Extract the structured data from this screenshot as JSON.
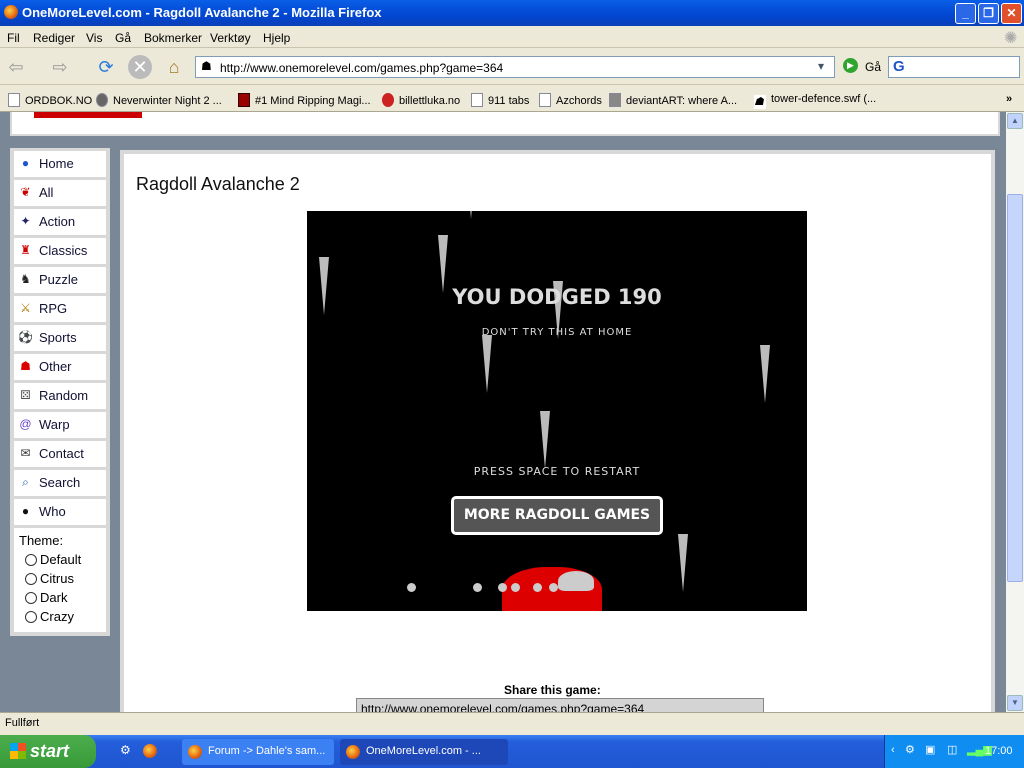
{
  "window": {
    "title": "OneMoreLevel.com - Ragdoll Avalanche 2 - Mozilla Firefox"
  },
  "menu": [
    "Fil",
    "Rediger",
    "Vis",
    "Gå",
    "Bokmerker",
    "Verktøy",
    "Hjelp"
  ],
  "toolbar": {
    "url": "http://www.onemorelevel.com/games.php?game=364",
    "go_label": "Gå"
  },
  "bookmarks": [
    "ORDBOK.NO",
    "Neverwinter Night 2 ...",
    "#1 Mind Ripping Magi...",
    "billettluka.no",
    "911 tabs",
    "Azchords",
    "deviantART: where A...",
    "tower-defence.swf (..."
  ],
  "sidebar": {
    "items": [
      {
        "label": "Home",
        "icon": "home-icon"
      },
      {
        "label": "All",
        "icon": "cherries-icon"
      },
      {
        "label": "Action",
        "icon": "action-icon"
      },
      {
        "label": "Classics",
        "icon": "mario-icon"
      },
      {
        "label": "Puzzle",
        "icon": "chess-icon"
      },
      {
        "label": "RPG",
        "icon": "swords-icon"
      },
      {
        "label": "Sports",
        "icon": "ball-icon"
      },
      {
        "label": "Other",
        "icon": "ghost-icon"
      },
      {
        "label": "Random",
        "icon": "dice-icon"
      },
      {
        "label": "Warp",
        "icon": "spiral-icon"
      },
      {
        "label": "Contact",
        "icon": "envelope-icon"
      },
      {
        "label": "Search",
        "icon": "magnifier-icon"
      },
      {
        "label": "Who",
        "icon": "person-icon"
      }
    ],
    "theme_label": "Theme:",
    "themes": [
      "Default",
      "Citrus",
      "Dark",
      "Crazy"
    ]
  },
  "main": {
    "title": "Ragdoll Avalanche 2",
    "game": {
      "score": "YOU DODGED 190",
      "tagline": "DON'T TRY THIS AT HOME",
      "restart": "PRESS SPACE TO RESTART",
      "more_button": "MORE RAGDOLL GAMES"
    },
    "share_label": "Share this game:",
    "share_url": "http://www.onemorelevel.com/games.php?game=364"
  },
  "status": "Fullført",
  "taskbar": {
    "start": "start",
    "tasks": [
      "Forum -> Dahle's sam...",
      "OneMoreLevel.com - ..."
    ],
    "clock": "17:00"
  }
}
